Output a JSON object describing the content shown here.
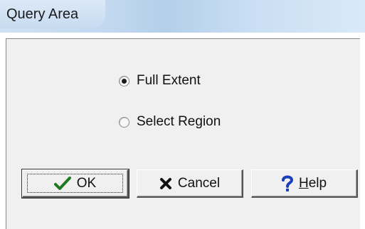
{
  "window": {
    "title": "Query Area"
  },
  "query_area": {
    "options": [
      {
        "label": "Full Extent",
        "checked": true
      },
      {
        "label": "Select Region",
        "checked": false
      }
    ]
  },
  "buttons": {
    "ok": {
      "label": "OK",
      "icon": "checkmark-icon"
    },
    "cancel": {
      "label": "Cancel",
      "icon": "x-icon"
    },
    "help": {
      "label_mnemonic": "H",
      "label_rest": "elp",
      "icon": "question-icon"
    }
  },
  "colors": {
    "check": "#1f7a1f",
    "x": "#111111",
    "question": "#1a3fb8"
  }
}
